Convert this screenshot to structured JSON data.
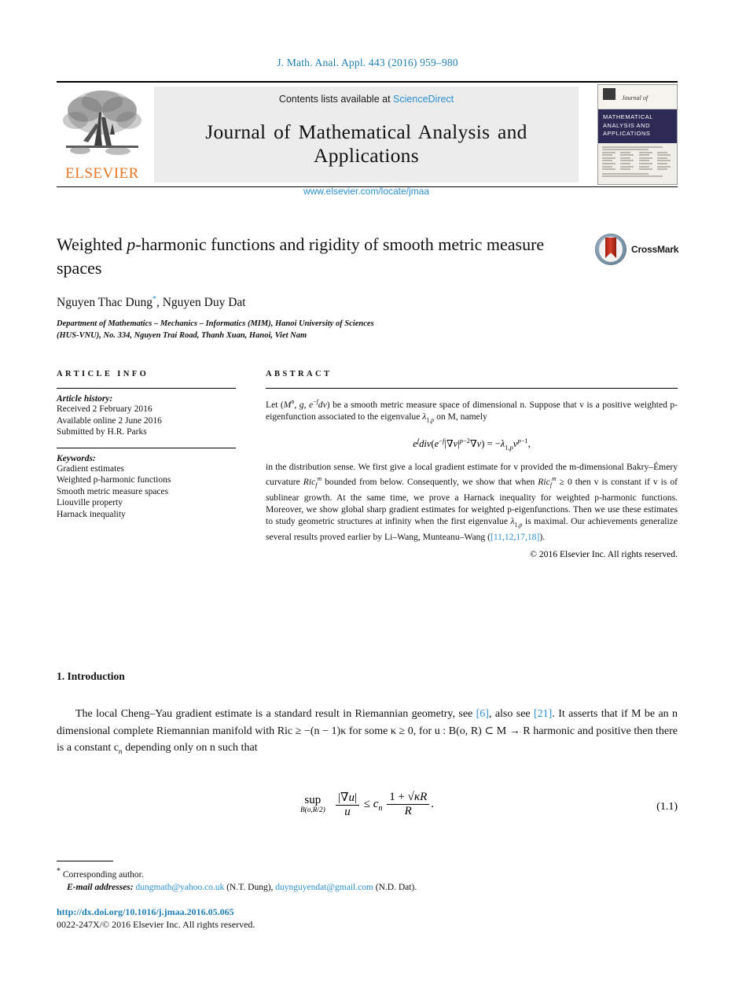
{
  "running_head": "J. Math. Anal. Appl. 443 (2016) 959–980",
  "masthead": {
    "publisher": "ELSEVIER",
    "contents_text": "Contents lists available at",
    "contents_link": "ScienceDirect",
    "journal_title": "Journal of Mathematical Analysis and Applications",
    "journal_url": "www.elsevier.com/locate/jmaa",
    "cover": {
      "journal_of": "Journal of",
      "band_line1": "MATHEMATICAL",
      "band_line2": "ANALYSIS AND",
      "band_line3": "APPLICATIONS"
    }
  },
  "article": {
    "title": "Weighted p-harmonic functions and rigidity of smooth metric measure spaces",
    "crossmark_label": "CrossMark",
    "authors": "Nguyen Thac Dung",
    "authors_second": ", Nguyen Duy Dat",
    "corresponding_marker": "*",
    "affiliation_line1": "Department of Mathematics – Mechanics – Informatics (MIM), Hanoi University of Sciences",
    "affiliation_line2": "(HUS-VNU), No. 334, Nguyen Trai Road, Thanh Xuan, Hanoi, Viet Nam"
  },
  "info": {
    "heading": "ARTICLE INFO",
    "history_label": "Article history:",
    "history": [
      "Received 2 February 2016",
      "Available online 2 June 2016",
      "Submitted by H.R. Parks"
    ],
    "keywords_label": "Keywords:",
    "keywords": [
      "Gradient estimates",
      "Weighted p-harmonic functions",
      "Smooth metric measure spaces",
      "Liouville property",
      "Harnack inequality"
    ]
  },
  "abstract": {
    "heading": "ABSTRACT",
    "paragraph1": "be a smooth metric measure space of dimensional n. Suppose that v is a positive weighted p-eigenfunction associated to the eigenvalue",
    "p1_prefix": "Let",
    "p1_space": "(M",
    "p1_tail": "on M, namely",
    "equation": "e^f div(e^{-f}|∇v|^{p−2}∇v) = −λ_{1,p} v^{p−1},",
    "paragraph2_a": "in the distribution sense. We first give a local gradient estimate for v provided the m-dimensional Bakry–Émery curvature",
    "paragraph2_b": "bounded from below. Consequently, we show that when",
    "paragraph2_c": "0 then v is constant if v is of sublinear growth. At the same time, we prove a Harnack inequality for weighted p-harmonic functions. Moreover, we show global sharp gradient estimates for weighted p-eigenfunctions. Then we use these estimates to study geometric structures at infinity when the first eigenvalue",
    "paragraph2_d": "is maximal. Our achievements generalize several results proved earlier by Li–Wang, Munteanu–Wang (",
    "citation": "[11,12,17,18]",
    "paragraph2_e": ").",
    "copyright": "© 2016 Elsevier Inc. All rights reserved."
  },
  "body": {
    "section_heading": "1. Introduction",
    "para_a": "The local Cheng–Yau gradient estimate is a standard result in Riemannian geometry, see",
    "ref6": "[6]",
    "para_b": ", also see",
    "ref21": "[21]",
    "para_c": ". It asserts that if M be an n dimensional complete Riemannian manifold with Ric ≥ −(n − 1)κ for some κ ≥ 0, for u : B(o, R) ⊂ M → R harmonic and positive then there is a constant c",
    "para_d": "depending only on n such that",
    "equation_number": "(1.1)",
    "equation_sup": "sup",
    "equation_sub": "B(o,R/2)"
  },
  "footer": {
    "corresponding_star": "*",
    "corresponding_text": "Corresponding author.",
    "email_label": "E-mail addresses:",
    "email1": "dungmath@yahoo.co.uk",
    "email1_owner": "(N.T. Dung),",
    "email2": "duynguyendat@gmail.com",
    "email2_owner": "(N.D. Dat).",
    "doi": "http://dx.doi.org/10.1016/j.jmaa.2016.05.065",
    "issn": "0022-247X/© 2016 Elsevier Inc. All rights reserved."
  },
  "colors": {
    "link_blue": "#2b8fd1",
    "runhead_blue": "#1f7fb5",
    "elsevier_orange": "#E87722",
    "cover_navy": "#2d2a55",
    "crossmark_red": "#d8402c"
  }
}
